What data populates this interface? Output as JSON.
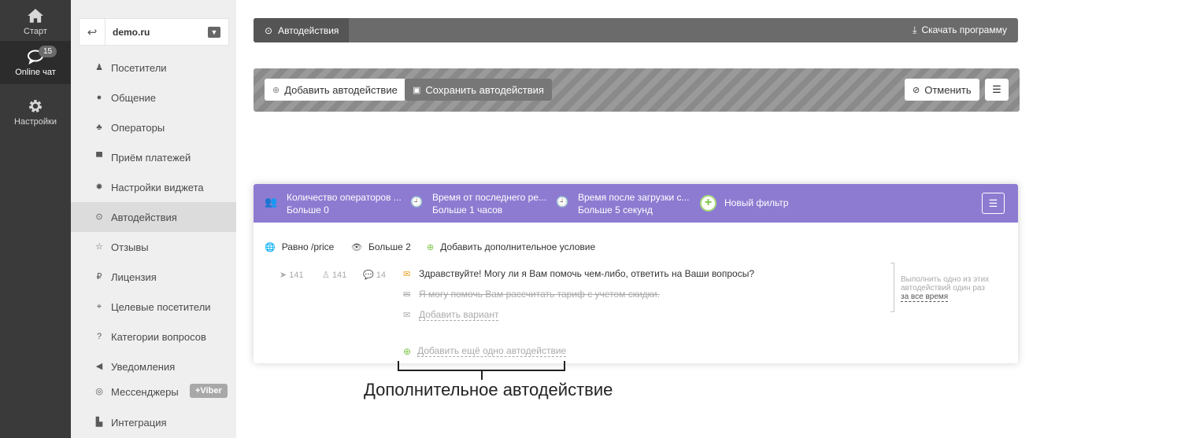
{
  "rail": {
    "items": [
      {
        "label": "Старт",
        "icon": "home-icon"
      },
      {
        "label": "Online чат",
        "icon": "chat-icon",
        "badge": "15"
      },
      {
        "label": "Настройки",
        "icon": "gear-icon"
      }
    ]
  },
  "sidebar": {
    "site": "demo.ru",
    "items": [
      {
        "label": "Посетители",
        "icon": "visitor-icon"
      },
      {
        "label": "Общение",
        "icon": "speech-bubble-icon"
      },
      {
        "label": "Операторы",
        "icon": "users-icon"
      },
      {
        "label": "Приём платежей",
        "icon": "cart-icon"
      },
      {
        "label": "Настройки виджета",
        "icon": "gear-icon"
      },
      {
        "label": "Автодействия",
        "icon": "clock-icon"
      },
      {
        "label": "Отзывы",
        "icon": "star-icon"
      },
      {
        "label": "Лицензия",
        "icon": "ruble-icon"
      },
      {
        "label": "Целевые посетители",
        "icon": "crosshair-icon"
      },
      {
        "label": "Категории вопросов",
        "icon": "question-icon"
      },
      {
        "label": "Уведомления",
        "icon": "megaphone-icon"
      },
      {
        "label": "Мессенджеры",
        "icon": "chat-icon",
        "tag": "+Viber"
      },
      {
        "label": "Интеграция",
        "icon": "puzzle-icon"
      }
    ]
  },
  "topbar": {
    "tab": "Автодействия",
    "download": "Скачать программу"
  },
  "toolbar": {
    "add": "Добавить автодействие",
    "save": "Сохранить автодействия",
    "cancel": "Отменить"
  },
  "card": {
    "filters": [
      {
        "title": "Количество операторов ...",
        "value": "Больше 0",
        "icon": "users-icon"
      },
      {
        "title": "Время от последнего ре...",
        "value": "Больше 1 часов",
        "icon": "clock-icon"
      },
      {
        "title": "Время после загрузки с...",
        "value": "Больше 5 секунд",
        "icon": "clock-icon"
      }
    ],
    "new_filter": "Новый фильтр",
    "conditions": [
      {
        "label": "Равно /price",
        "icon": "globe-icon"
      },
      {
        "label": "Больше 2",
        "icon": "eye-icon"
      },
      {
        "label": "Добавить дополнительное условие",
        "icon": "plus-circle-icon"
      }
    ],
    "stats": [
      {
        "value": "141",
        "icon": "send-icon"
      },
      {
        "value": "141",
        "icon": "user-icon"
      },
      {
        "value": "14",
        "icon": "comment-icon"
      }
    ],
    "messages": {
      "main": "Здравствуйте! Могу ли я Вам помочь чем-либо, ответить на Ваши вопросы?",
      "disabled": "Я могу помочь Вам рассчитать тариф с учетом скидки.",
      "add_variant": "Добавить вариант"
    },
    "add_more": "Добавить ещё одно автодействие",
    "once_text": "Выполнить одно из этих автодействий один раз",
    "once_link": "за все время"
  },
  "annotation": "Дополнительное автодействие",
  "colors": {
    "accent": "#8d7bd1",
    "rail": "#3a3a3a",
    "sidebar": "#efefef",
    "add_green": "#7cc447",
    "mail_orange": "#f0a020"
  }
}
